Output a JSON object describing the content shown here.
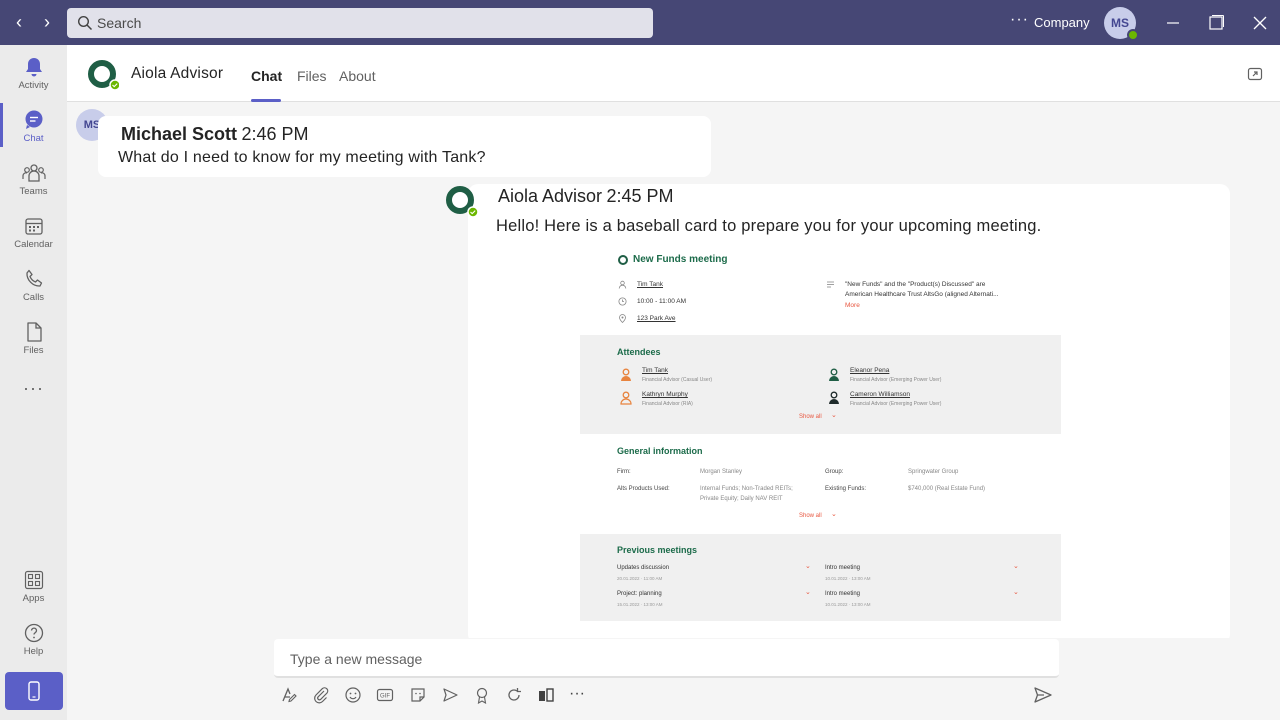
{
  "titlebar": {
    "back_arrow": "‹",
    "forward_arrow": "›",
    "search_placeholder": "Search",
    "more": "···",
    "org_name": "Company",
    "user_initials": "MS"
  },
  "rail": {
    "items": [
      {
        "label": "Activity",
        "icon": "bell-icon"
      },
      {
        "label": "Chat",
        "icon": "chat-icon"
      },
      {
        "label": "Teams",
        "icon": "teams-icon"
      },
      {
        "label": "Calendar",
        "icon": "calendar-icon"
      },
      {
        "label": "Calls",
        "icon": "phone-icon"
      },
      {
        "label": "Files",
        "icon": "file-icon"
      }
    ],
    "more": "···",
    "bottom": [
      {
        "label": "Apps",
        "icon": "apps-icon"
      },
      {
        "label": "Help",
        "icon": "help-icon"
      }
    ]
  },
  "header": {
    "app_name": "Aiola Advisor",
    "tabs": [
      "Chat",
      "Files",
      "About"
    ],
    "active_tab": "Chat"
  },
  "messages": {
    "user": {
      "initials": "MS",
      "name": "Michael Scott",
      "time": "2:46 PM",
      "text": "What do I need to know for my meeting with Tank?"
    },
    "bot": {
      "name": "Aiola Advisor",
      "time": "2:45 PM",
      "text": "Hello! Here is a baseball card to prepare you for your upcoming meeting."
    }
  },
  "card": {
    "title": "New Funds meeting",
    "contact": "Tim Tank",
    "time": "10:00 - 11:00 AM",
    "location": "123 Park Ave",
    "note_line1": "\"New Funds\" and the \"Product(s) Discussed\" are",
    "note_line2": "American Healthcare Trust AltsGo (aligned Alternati...",
    "more": "More",
    "attendees": {
      "title": "Attendees",
      "people": [
        {
          "name": "Tim Tank",
          "role": "Financial Advisor (Casual User)"
        },
        {
          "name": "Eleanor Pena",
          "role": "Financial Advisor (Emerging Power User)"
        },
        {
          "name": "Kathryn Murphy",
          "role": "Financial Advisor (RIA)"
        },
        {
          "name": "Cameron Williamson",
          "role": "Financial Advisor (Emerging Power User)"
        }
      ],
      "show_all": "Show all"
    },
    "general": {
      "title": "General information",
      "firm_label": "Firm:",
      "firm": "Morgan Stanley",
      "group_label": "Group:",
      "group": "Springwater Group",
      "alts_label": "Alts Products Used:",
      "alts_line1": "Internal Funds; Non-Traded REITs;",
      "alts_line2": "Private Equity; Daily NAV REIT",
      "existing_label": "Existing Funds:",
      "existing": "$740,000 (Real Estate Fund)",
      "show_all": "Show all"
    },
    "previous": {
      "title": "Previous meetings",
      "items": [
        {
          "name": "Updates discussion",
          "date": "20.01.2022 · 11:00 AM"
        },
        {
          "name": "Intro meeting",
          "date": "10.01.2022 · 13:00 AM"
        },
        {
          "name": "Project: planning",
          "date": "15.01.2022 · 13:00 AM"
        },
        {
          "name": "Intro meeting",
          "date": "10.01.2022 · 13:00 AM"
        }
      ]
    },
    "chevron": "⌄"
  },
  "compose": {
    "placeholder": "Type a new message",
    "more": "···"
  },
  "colors": {
    "titlebar": "#464775",
    "accent": "#5b5fc7",
    "brand_green": "#1f5e45",
    "presence": "#6bb700",
    "card_red": "#e8563f"
  }
}
